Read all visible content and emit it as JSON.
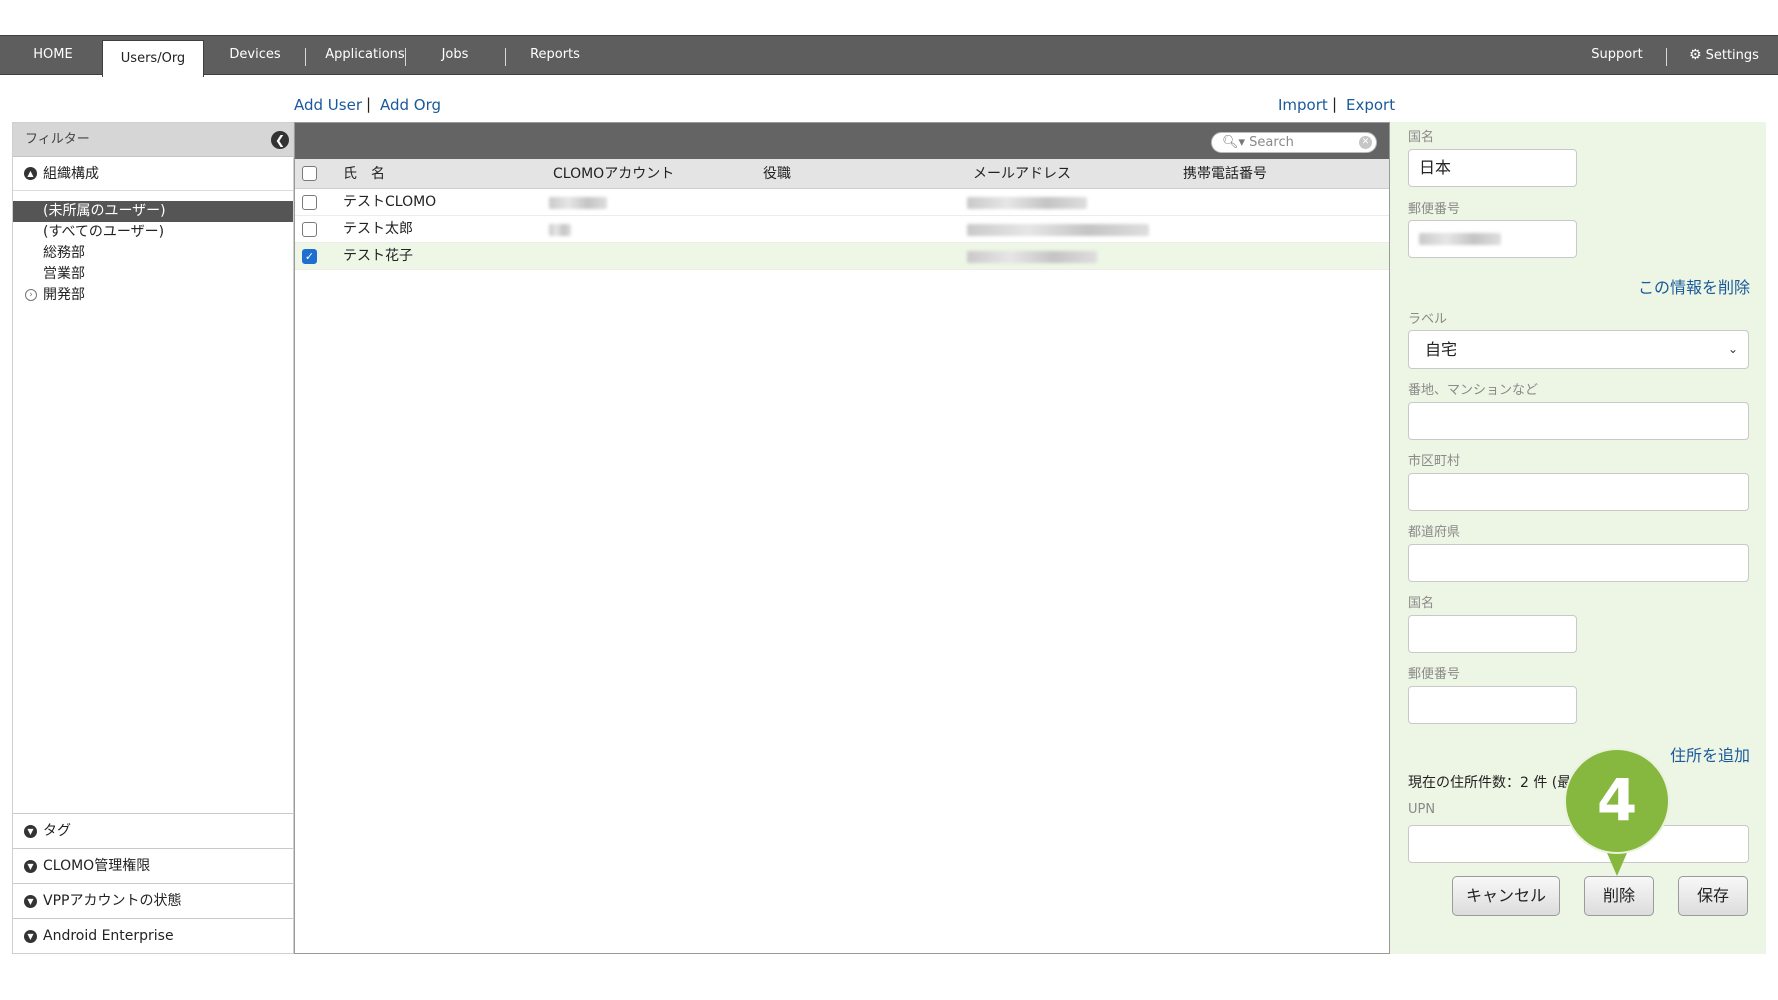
{
  "nav": {
    "tabs": [
      {
        "label": "HOME"
      },
      {
        "label": "Users/Org"
      },
      {
        "label": "Devices"
      },
      {
        "label": "Applications"
      },
      {
        "label": "Jobs"
      },
      {
        "label": "Reports"
      }
    ],
    "support": "Support",
    "settings": "Settings",
    "active_tab": "Users/Org"
  },
  "actions": {
    "add_user": "Add User",
    "add_org": "Add Org",
    "import": "Import",
    "export": "Export",
    "separator": "|"
  },
  "filter": {
    "title": "フィルター",
    "org_section": "組織構成",
    "tree": [
      {
        "label": "(未所属のユーザー)"
      },
      {
        "label": "(すべてのユーザー)"
      },
      {
        "label": "総務部"
      },
      {
        "label": "営業部"
      },
      {
        "label": "開発部"
      }
    ],
    "bottom_sections": [
      {
        "label": "タグ"
      },
      {
        "label": "CLOMO管理権限"
      },
      {
        "label": "VPPアカウントの状態"
      },
      {
        "label": "Android Enterprise"
      }
    ]
  },
  "table": {
    "search_placeholder": "Search",
    "columns": [
      "氏　名",
      "CLOMOアカウント",
      "役職",
      "メールアドレス",
      "携帯電話番号"
    ],
    "rows": [
      {
        "name": "テストCLOMO",
        "checked": false
      },
      {
        "name": "テスト太郎",
        "checked": false
      },
      {
        "name": "テスト花子",
        "checked": true
      }
    ]
  },
  "detail": {
    "country_label": "国名",
    "country_value": "日本",
    "postal_label": "郵便番号",
    "delete_info": "この情報を削除",
    "label_label": "ラベル",
    "label_value": "自宅",
    "street_label": "番地、マンションなど",
    "city_label": "市区町村",
    "prefecture_label": "都道府県",
    "country2_label": "国名",
    "postal2_label": "郵便番号",
    "add_address": "住所を追加",
    "address_count": "現在の住所件数：2 件 (最",
    "upn_label": "UPN",
    "cancel": "キャンセル",
    "delete": "削除",
    "save": "保存"
  },
  "marker": "4",
  "colors": {
    "nav_bg": "#5e5e5e",
    "link": "#1a5a9c",
    "panel_bg": "#edf5e4",
    "marker": "#86b73e",
    "selected_row": "#eef6e6"
  }
}
